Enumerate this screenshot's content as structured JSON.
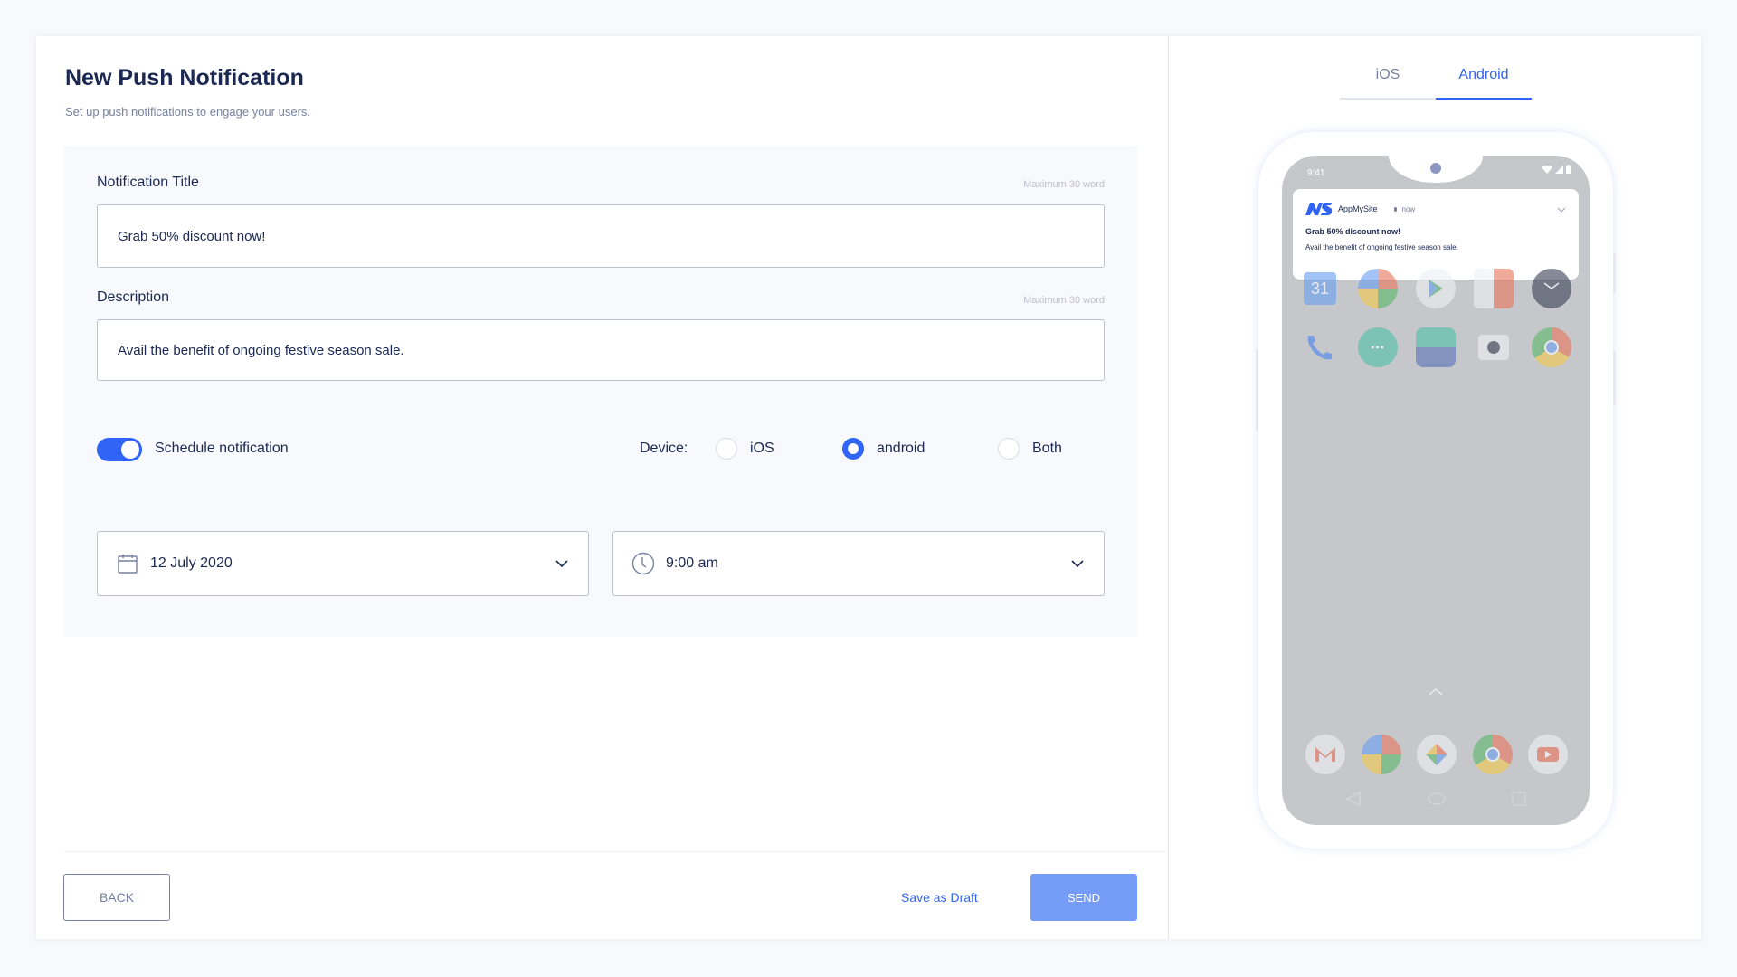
{
  "header": {
    "title": "New Push Notification",
    "subtitle": "Set up push notifications to engage your users."
  },
  "form": {
    "title_field": {
      "label": "Notification Title",
      "hint": "Maximum 30 word",
      "value": "Grab 50% discount now!"
    },
    "description_field": {
      "label": "Description",
      "hint": "Maximum 30 word",
      "value": "Avail the benefit of ongoing festive season sale."
    },
    "schedule": {
      "label": "Schedule notification",
      "enabled": true
    },
    "device": {
      "label": "Device:",
      "options": [
        {
          "label": "iOS",
          "selected": false
        },
        {
          "label": "android",
          "selected": true
        },
        {
          "label": "Both",
          "selected": false
        }
      ]
    },
    "date_select": {
      "value": "12 July 2020",
      "icon": "calendar-icon"
    },
    "time_select": {
      "value": "9:00 am",
      "icon": "clock-icon"
    }
  },
  "footer": {
    "back_label": "BACK",
    "draft_label": "Save as Draft",
    "send_label": "SEND"
  },
  "preview": {
    "tabs": [
      {
        "label": "iOS",
        "active": false
      },
      {
        "label": "Android",
        "active": true
      }
    ],
    "status_time": "9:41",
    "notification": {
      "app_name": "AppMySite",
      "time": "now",
      "title": "Grab 50% discount now!",
      "body": "Avail the benefit of ongoing festive season sale."
    },
    "home_row_1": [
      "calendar",
      "maps",
      "play-store",
      "calculator",
      "clock"
    ],
    "home_row_2": [
      "phone",
      "messages",
      "gallery",
      "camera",
      "chrome"
    ],
    "dock": [
      "gmail",
      "maps",
      "photos",
      "chrome",
      "youtube"
    ],
    "calendar_day": "31"
  },
  "colors": {
    "accent": "#3064f6",
    "send_button": "#759cf7",
    "text_primary": "#1b2952",
    "text_secondary": "#7782a1"
  }
}
